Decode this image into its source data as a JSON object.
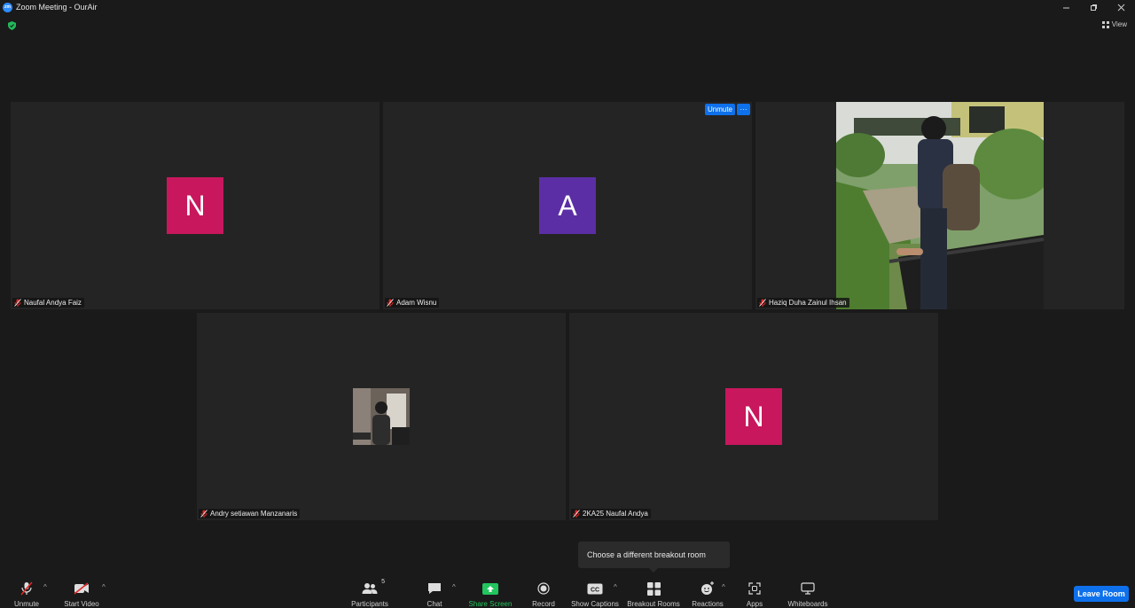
{
  "window": {
    "title": "Zoom Meeting - OurAir",
    "controls": [
      "minimize-icon",
      "restore-icon",
      "close-icon"
    ]
  },
  "header": {
    "view_label": "View"
  },
  "participants": [
    {
      "name": "Naufal Andya Faiz",
      "initial": "N",
      "color": "#c8175d",
      "muted": true
    },
    {
      "name": "Adam Wisnu",
      "initial": "A",
      "color": "#5b2ea6",
      "muted": true,
      "actions": {
        "unmute_label": "Unmute",
        "more_label": "···"
      }
    },
    {
      "name": "Haziq Duha Zainul Ihsan",
      "muted": true,
      "video": true
    },
    {
      "name": "Andry setiawan Manzanaris",
      "muted": true,
      "video": true
    },
    {
      "name": "2KA25 Naufal Andya",
      "initial": "N",
      "color": "#c8175d",
      "muted": true
    }
  ],
  "tooltip": {
    "text": "Choose a different breakout room"
  },
  "toolbar": {
    "unmute": "Unmute",
    "start_video": "Start Video",
    "participants": "Participants",
    "participants_count": "5",
    "chat": "Chat",
    "share_screen": "Share Screen",
    "record": "Record",
    "show_captions": "Show Captions",
    "breakout_rooms": "Breakout Rooms",
    "reactions": "Reactions",
    "apps": "Apps",
    "whiteboards": "Whiteboards",
    "leave_room": "Leave Room",
    "accent_color": "#0e71eb",
    "share_color": "#22c55e"
  }
}
